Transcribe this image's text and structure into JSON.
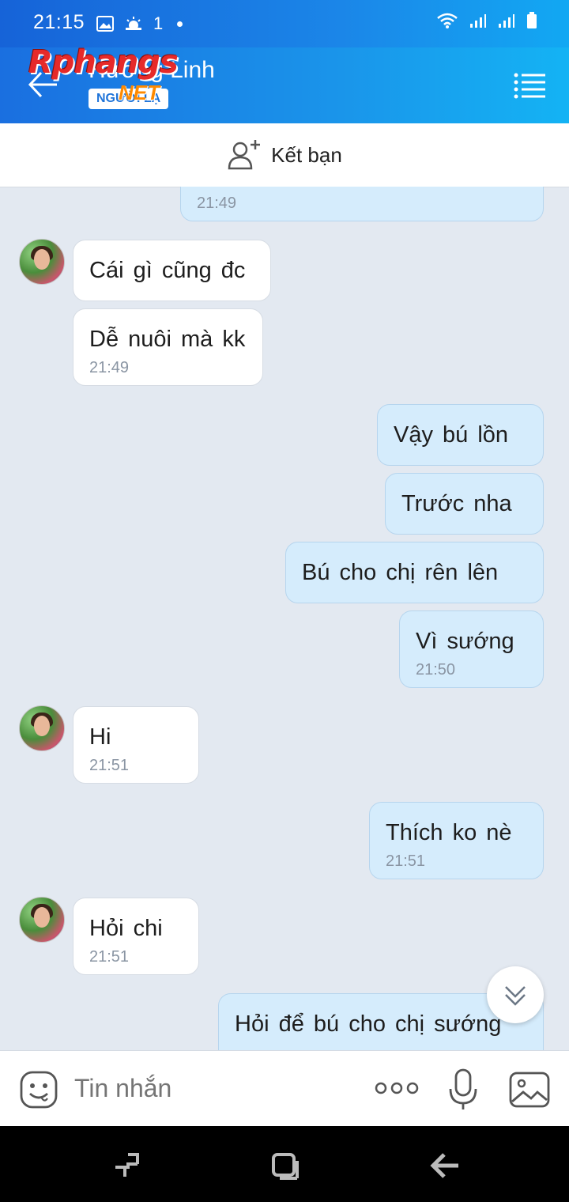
{
  "status_bar": {
    "time": "21:15",
    "signal_extra": "1",
    "battery_icon": "battery-icon"
  },
  "header": {
    "contact_name": "Hương Linh",
    "badge": "NGƯỜI LẠ",
    "watermark_main": "Rphangs",
    "watermark_sub": "NET"
  },
  "add_friend": {
    "label": "Kết bạn"
  },
  "messages": [
    {
      "id": "m0",
      "dir": "out",
      "text": "",
      "time": "21:49"
    },
    {
      "id": "m1",
      "dir": "in",
      "text": "Cái gì cũng đc",
      "time": ""
    },
    {
      "id": "m2",
      "dir": "in",
      "text": "Dễ nuôi mà kk",
      "time": "21:49"
    },
    {
      "id": "m3",
      "dir": "out",
      "text": "Vậy bú lồn",
      "time": ""
    },
    {
      "id": "m4",
      "dir": "out",
      "text": "Trước nha",
      "time": ""
    },
    {
      "id": "m5",
      "dir": "out",
      "text": "Bú cho chị rên lên",
      "time": ""
    },
    {
      "id": "m6",
      "dir": "out",
      "text": "Vì sướng",
      "time": "21:50"
    },
    {
      "id": "m7",
      "dir": "in",
      "text": "Hi",
      "time": "21:51"
    },
    {
      "id": "m8",
      "dir": "out",
      "text": "Thích ko nè",
      "time": "21:51"
    },
    {
      "id": "m9",
      "dir": "in",
      "text": "Hỏi chi",
      "time": "21:51"
    },
    {
      "id": "m10",
      "dir": "out",
      "text": "Hỏi để bú cho chị sướng",
      "time": ""
    }
  ],
  "input": {
    "placeholder": "Tin nhắn"
  },
  "colors": {
    "header_start": "#1a6fe0",
    "header_end": "#14b3f4",
    "outgoing_bubble": "#d5ecfc",
    "incoming_bubble": "#ffffff",
    "chat_bg": "#e3e9f1"
  }
}
